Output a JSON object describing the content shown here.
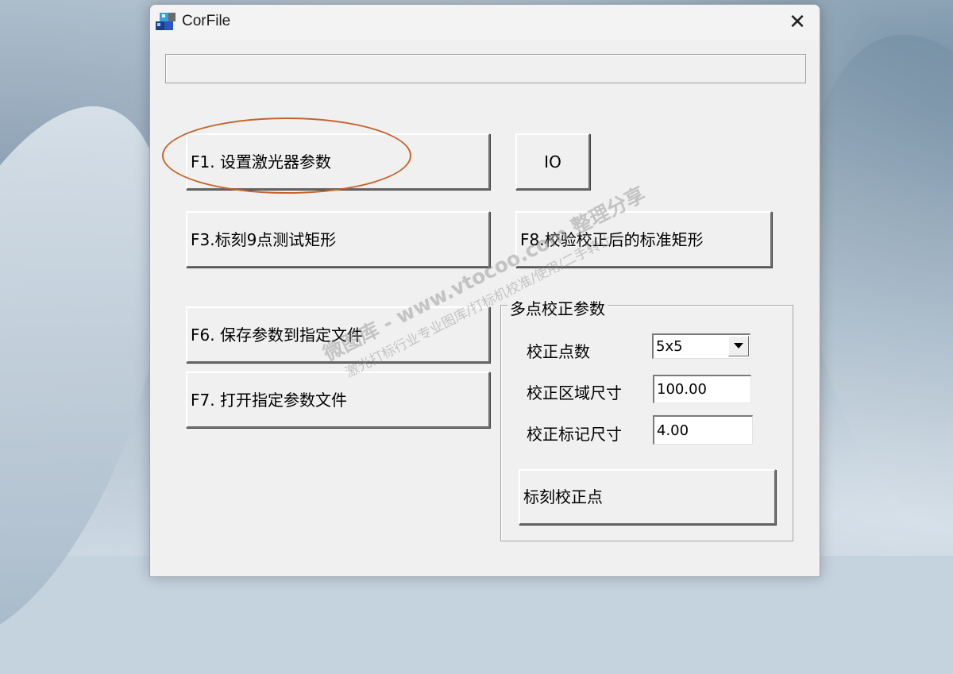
{
  "window": {
    "title": "CorFile",
    "close_glyph": "✕"
  },
  "buttons": {
    "f1": "F1. 设置激光器参数",
    "io": "IO",
    "f3": "F3.标刻9点测试矩形",
    "f8": "F8.校验校正后的标准矩形",
    "f6": "F6. 保存参数到指定文件",
    "f7": "F7. 打开指定参数文件"
  },
  "multipoint": {
    "group_title": "多点校正参数",
    "points_label": "校正点数",
    "points_value": "5x5",
    "area_label": "校正区域尺寸",
    "area_value": "100.00",
    "mark_label": "校正标记尺寸",
    "mark_value": "4.00",
    "mark_button": "标刻校正点"
  },
  "watermark": {
    "line1": "微图库 - www.vtocoo.com 整理分享",
    "line2": "激光打标行业专业图库/打标机校准/使用/二手转让"
  },
  "colors": {
    "highlight_ellipse": "#c4642a",
    "dialog_bg": "#f0f0f0"
  },
  "icons": {
    "app": "corfile-app-icon",
    "close": "close-icon",
    "dropdown": "chevron-down-icon"
  }
}
